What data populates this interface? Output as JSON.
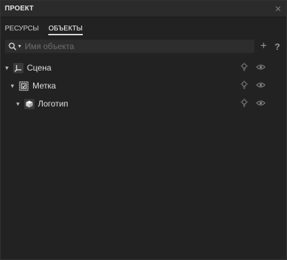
{
  "panel": {
    "title": "ПРОЕКТ",
    "close_icon": "close-icon"
  },
  "tabs": [
    {
      "label": "РЕСУРСЫ",
      "active": false
    },
    {
      "label": "ОБЪЕКТЫ",
      "active": true
    }
  ],
  "search": {
    "placeholder": "Имя объекта",
    "value": "",
    "icon": "search-icon"
  },
  "toolbar": {
    "add_label": "+",
    "help_label": "?"
  },
  "tree": [
    {
      "label": "Сцена",
      "icon": "scene-axes-icon",
      "depth": 0,
      "expanded": true
    },
    {
      "label": "Метка",
      "icon": "marker-icon",
      "depth": 1,
      "expanded": true
    },
    {
      "label": "Логотип",
      "icon": "cube-icon",
      "depth": 2,
      "expanded": true
    }
  ],
  "colors": {
    "background": "#222222",
    "header": "#2b2b2b",
    "text": "#e0e0e0",
    "muted": "#6f6f6f"
  }
}
